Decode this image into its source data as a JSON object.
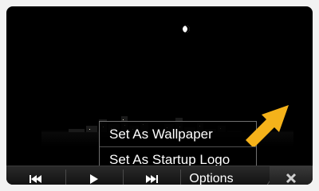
{
  "menu": {
    "items": [
      {
        "label": "Set As Wallpaper"
      },
      {
        "label": "Set As Startup Logo"
      }
    ]
  },
  "toolbar": {
    "options_label": "Options"
  },
  "icons": {
    "prev": "skip-previous-icon",
    "play": "play-icon",
    "next": "skip-next-icon",
    "close": "close-icon"
  },
  "colors": {
    "arrow": "#f5b21a",
    "menu_text": "#ffffff"
  }
}
